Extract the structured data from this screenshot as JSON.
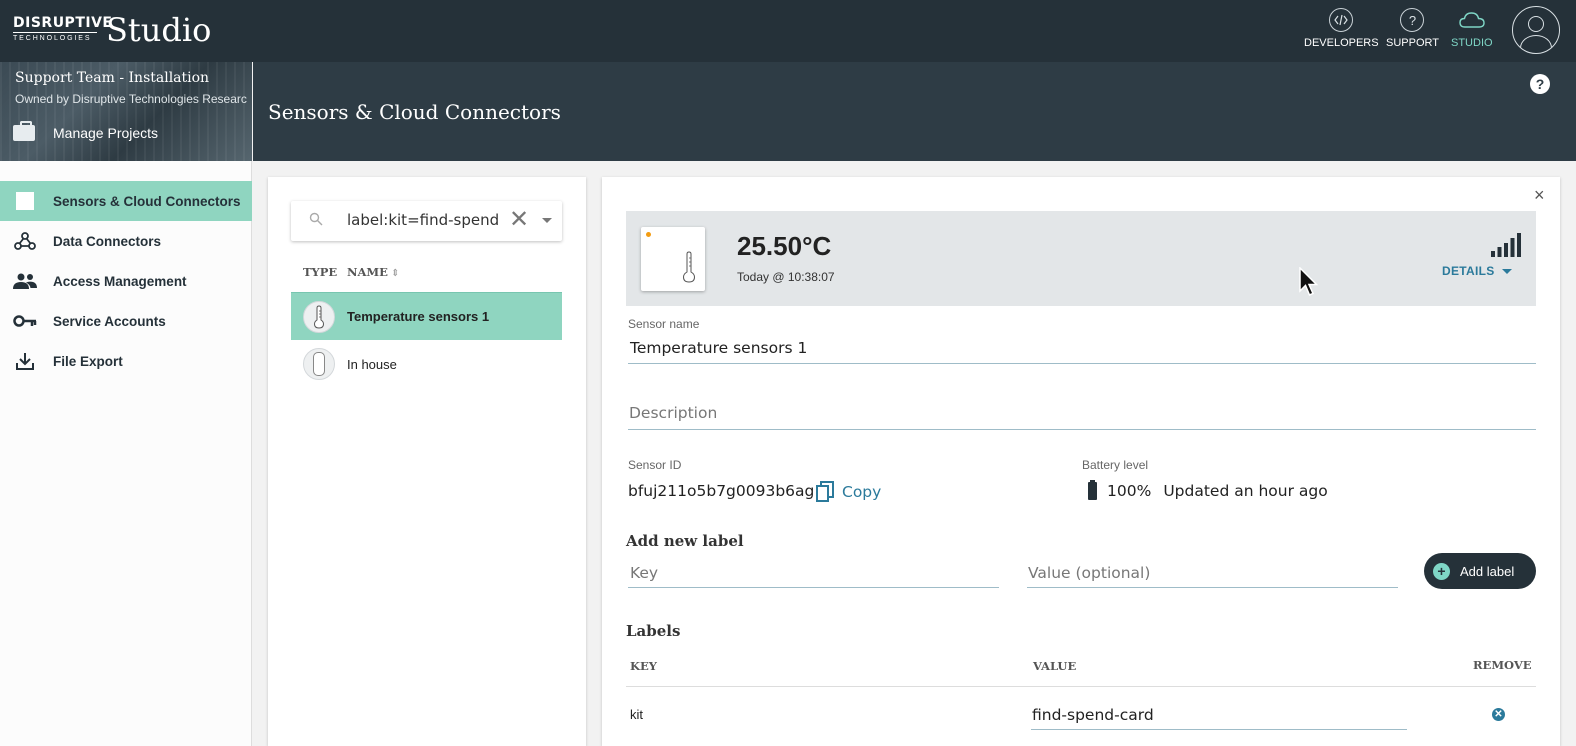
{
  "topbar": {
    "brand_line1": "DISRUPTIVE",
    "brand_line2": "TECHNOLOGIES",
    "app_name": "Studio",
    "nav": [
      {
        "label": "DEVELOPERS",
        "icon": "code-icon"
      },
      {
        "label": "SUPPORT",
        "icon": "question-icon"
      },
      {
        "label": "STUDIO",
        "icon": "cloud-icon"
      }
    ],
    "colors": {
      "background": "#253139",
      "active": "#7fd6c6"
    }
  },
  "project": {
    "title": "Support Team - Installation",
    "owner": "Owned by Disruptive Technologies Researc",
    "manage_label": "Manage Projects"
  },
  "sidebar": {
    "items": [
      {
        "label": "Sensors & Cloud Connectors",
        "icon": "square-icon",
        "active": true
      },
      {
        "label": "Data Connectors",
        "icon": "webhook-icon"
      },
      {
        "label": "Access Management",
        "icon": "people-icon"
      },
      {
        "label": "Service Accounts",
        "icon": "key-icon"
      },
      {
        "label": "File Export",
        "icon": "download-icon"
      }
    ],
    "active_color": "#8fd5c0"
  },
  "header": {
    "title": "Sensors & Cloud Connectors",
    "help_label": "?"
  },
  "list": {
    "search_value": "label:kit=find-spend-card",
    "col_type": "TYPE",
    "col_name": "NAME",
    "rows": [
      {
        "name": "Temperature sensors 1",
        "selected": true
      },
      {
        "name": "In house",
        "selected": false
      }
    ]
  },
  "detail": {
    "temperature": "25.50°C",
    "timestamp": "Today @ 10:38:07",
    "details_label": "DETAILS",
    "sensor_name_label": "Sensor name",
    "sensor_name": "Temperature sensors 1",
    "description_placeholder": "Description",
    "sensor_id_label": "Sensor ID",
    "sensor_id": "bfuj211o5b7g0093b6ag",
    "copy_label": "Copy",
    "battery_label": "Battery level",
    "battery_percent": "100%",
    "battery_updated": "Updated an hour ago",
    "add_label_heading": "Add new label",
    "key_placeholder": "Key",
    "value_placeholder": "Value (optional)",
    "add_button": "Add label",
    "labels_heading": "Labels",
    "table_headers": {
      "key": "KEY",
      "value": "VALUE",
      "remove": "REMOVE"
    },
    "labels": [
      {
        "key": "kit",
        "value": "find-spend-card"
      }
    ],
    "close_label": "×"
  }
}
